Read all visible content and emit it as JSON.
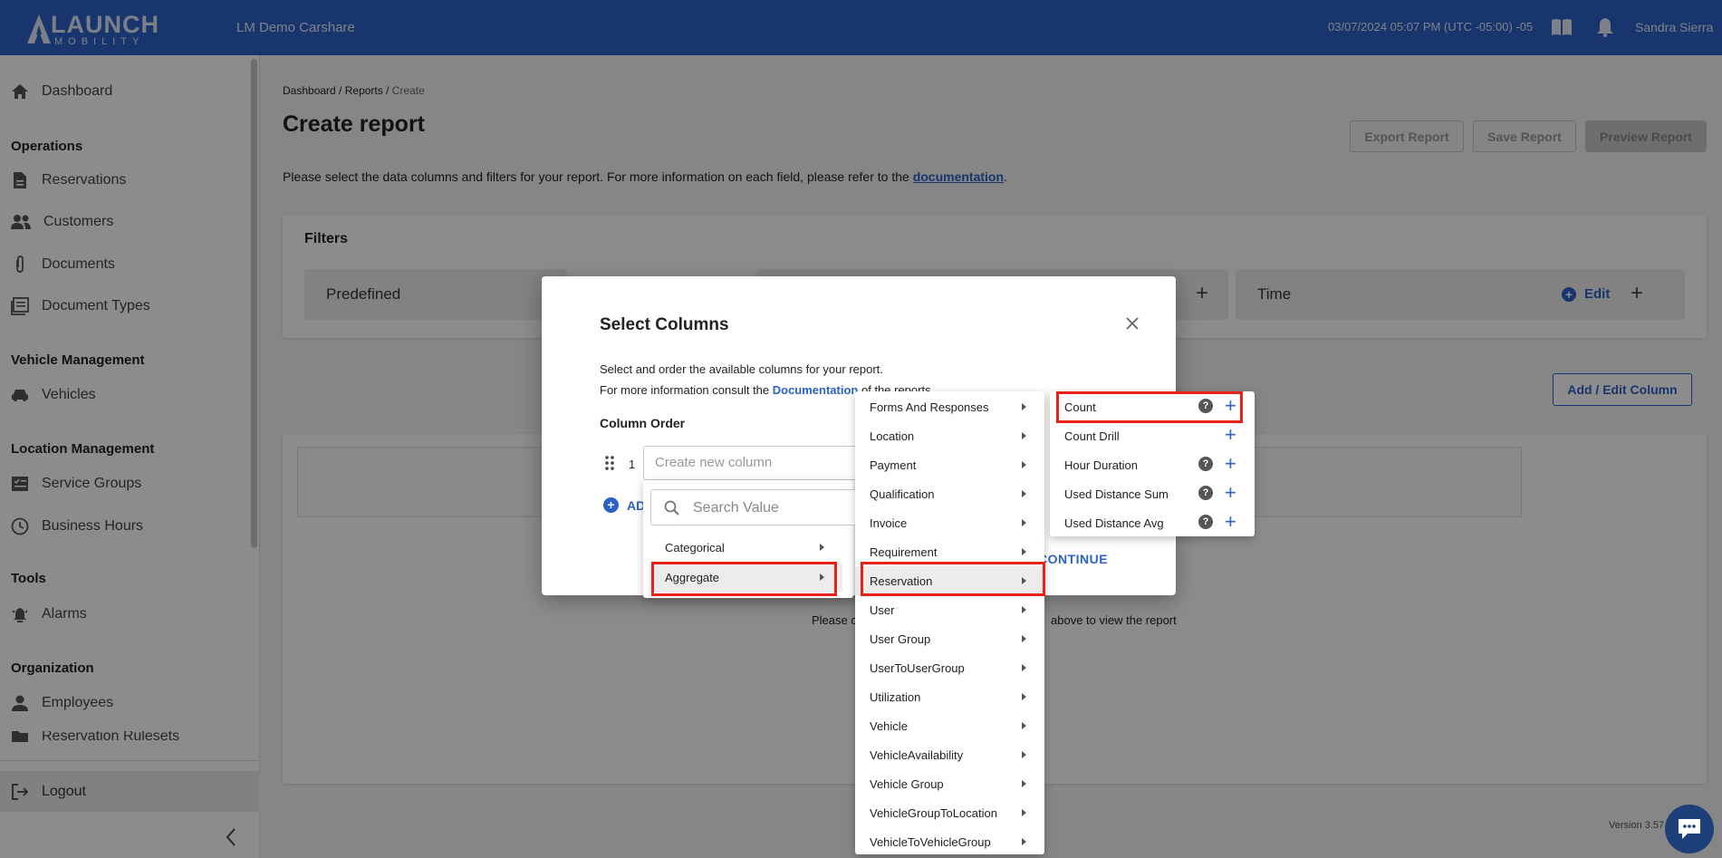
{
  "header": {
    "logo_text": "LAUNCH",
    "logo_sub": "MOBILITY",
    "tenant": "LM Demo Carshare",
    "datetime": "03/07/2024 05:07 PM (UTC -05:00) -05",
    "user": "Sandra Sierra"
  },
  "sidebar": {
    "dashboard": "Dashboard",
    "sec_operations": "Operations",
    "reservations": "Reservations",
    "customers": "Customers",
    "documents": "Documents",
    "document_types": "Document Types",
    "sec_vehicle": "Vehicle Management",
    "vehicles": "Vehicles",
    "sec_location": "Location Management",
    "service_groups": "Service Groups",
    "business_hours": "Business Hours",
    "sec_tools": "Tools",
    "alarms": "Alarms",
    "sec_org": "Organization",
    "employees": "Employees",
    "reservation_rulesets": "Reservation Rulesets",
    "logout": "Logout"
  },
  "breadcrumb": {
    "a": "Dashboard",
    "b": "Reports",
    "c": "Create"
  },
  "page": {
    "title": "Create report",
    "export": "Export Report",
    "save": "Save Report",
    "preview": "Preview Report",
    "intro": "Please select the data columns and filters for your report. For more information on each field, please refer to the ",
    "intro_link": "documentation",
    "filters_title": "Filters",
    "filter_predefined": "Predefined",
    "filter_time": "Time",
    "edit": "Edit",
    "add_edit_column": "Add / Edit Column",
    "report_msg_left": "Please c",
    "report_msg_right": "above to view the report",
    "version": "Version 3.57"
  },
  "dialog": {
    "title": "Select Columns",
    "desc1": "Select and order the available columns for your report.",
    "desc2_pre": "For more information consult the ",
    "desc2_link": "Documentation",
    "desc2_post": " of the reports.",
    "column_order": "Column Order",
    "row_num": "1",
    "new_column_placeholder": "Create new column",
    "add_label": "ADD",
    "continue": "CONTINUE"
  },
  "search_placeholder": "Search Value",
  "type_menu": [
    "Categorical",
    "Aggregate"
  ],
  "entity_menu": [
    "Forms And Responses",
    "Location",
    "Payment",
    "Qualification",
    "Invoice",
    "Requirement",
    "Reservation",
    "User",
    "User Group",
    "UserToUserGroup",
    "Utilization",
    "Vehicle",
    "VehicleAvailability",
    "Vehicle Group",
    "VehicleGroupToLocation",
    "VehicleToVehicleGroup"
  ],
  "measure_menu": [
    "Count",
    "Count Drill",
    "Hour Duration",
    "Used Distance Sum",
    "Used Distance Avg"
  ],
  "colors": {
    "brand": "#2c62c7",
    "highlight_box": "#e8221b"
  }
}
